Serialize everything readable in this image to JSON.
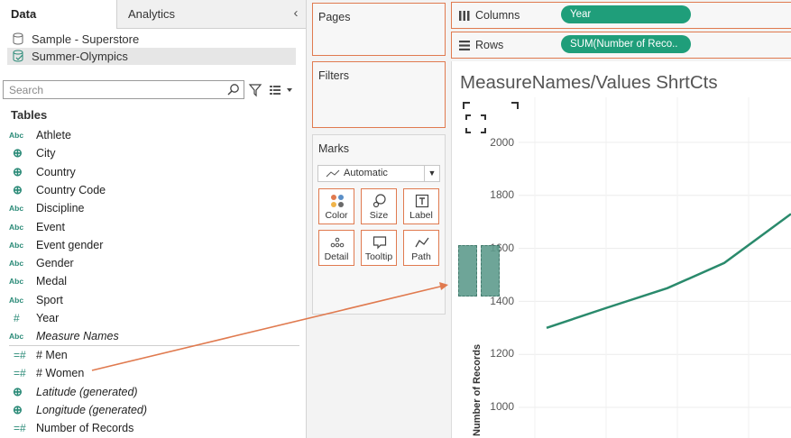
{
  "tabs": {
    "data": "Data",
    "analytics": "Analytics"
  },
  "sources": [
    {
      "name": "Sample - Superstore"
    },
    {
      "name": "Summer-Olympics"
    }
  ],
  "search": {
    "placeholder": "Search"
  },
  "tables_heading": "Tables",
  "dimensions": [
    {
      "icon": "Abc",
      "label": "Athlete"
    },
    {
      "icon": "globe",
      "label": "City"
    },
    {
      "icon": "globe",
      "label": "Country"
    },
    {
      "icon": "globe",
      "label": "Country Code"
    },
    {
      "icon": "Abc",
      "label": "Discipline"
    },
    {
      "icon": "Abc",
      "label": "Event"
    },
    {
      "icon": "Abc",
      "label": "Event gender"
    },
    {
      "icon": "Abc",
      "label": "Gender"
    },
    {
      "icon": "Abc",
      "label": "Medal"
    },
    {
      "icon": "Abc",
      "label": "Sport"
    },
    {
      "icon": "#",
      "label": "Year"
    },
    {
      "icon": "Abc",
      "label": "Measure Names"
    }
  ],
  "measures": [
    {
      "icon": "=#",
      "label": "# Men"
    },
    {
      "icon": "=#",
      "label": "# Women"
    },
    {
      "icon": "globe",
      "label": "Latitude (generated)"
    },
    {
      "icon": "globe",
      "label": "Longitude (generated)"
    },
    {
      "icon": "=#",
      "label": "Number of Records"
    }
  ],
  "cards": {
    "pages": "Pages",
    "filters": "Filters",
    "marks": "Marks"
  },
  "marks": {
    "type": "Automatic",
    "buttons": [
      "Color",
      "Size",
      "Label",
      "Detail",
      "Tooltip",
      "Path"
    ]
  },
  "shelves": {
    "columns_label": "Columns",
    "columns_pill": "Year",
    "rows_label": "Rows",
    "rows_pill": "SUM(Number of Reco.."
  },
  "view": {
    "title": "MeasureNames/Values ShrtCts",
    "y_ticks": [
      "2000",
      "1800",
      "1600",
      "1400",
      "1200",
      "1000"
    ],
    "y_label": "Number of Records"
  },
  "colors": {
    "accent_green": "#1f9e7a",
    "line": "#2a8a6c",
    "highlight_border": "#e07a4f"
  },
  "chart_data": {
    "type": "line",
    "ylabel": "Number of Records",
    "yticks": [
      1000,
      1200,
      1400,
      1600,
      1800,
      2000
    ],
    "ylim": [
      900,
      2100
    ],
    "series": [
      {
        "values": [
          1300,
          1375,
          1450,
          1545,
          1730
        ]
      }
    ]
  }
}
